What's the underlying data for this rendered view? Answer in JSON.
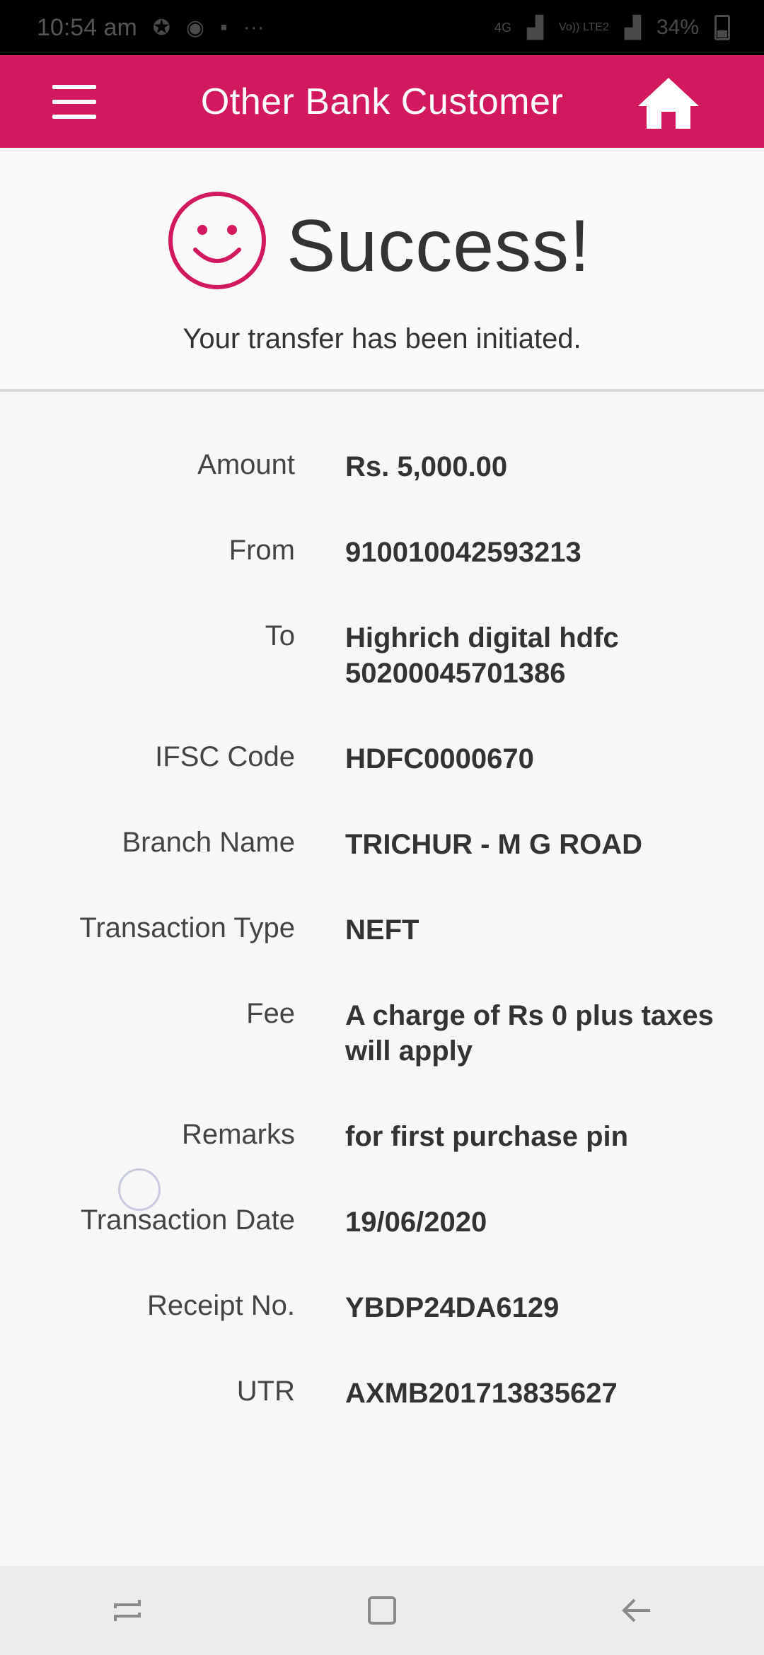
{
  "status_bar": {
    "time": "10:54 am",
    "more": "···",
    "network": "4G",
    "volte": "Vo)) LTE2",
    "battery": "34%"
  },
  "app_bar": {
    "title": "Other Bank Customer"
  },
  "success": {
    "title": "Success!",
    "message": "Your transfer has been initiated."
  },
  "details": [
    {
      "label": "Amount",
      "value": "Rs. 5,000.00"
    },
    {
      "label": "From",
      "value": "910010042593213"
    },
    {
      "label": "To",
      "value_line1": "Highrich digital hdfc",
      "value_line2": "50200045701386"
    },
    {
      "label": "IFSC Code",
      "value": "HDFC0000670"
    },
    {
      "label": "Branch Name",
      "value": "TRICHUR - M G ROAD"
    },
    {
      "label": "Transaction Type",
      "value": "NEFT"
    },
    {
      "label": "Fee",
      "value_line1": "A charge of Rs 0 plus taxes",
      "value_line2": "will apply"
    },
    {
      "label": "Remarks",
      "value": "for first purchase pin"
    },
    {
      "label": "Transaction Date",
      "value": "19/06/2020"
    },
    {
      "label": "Receipt No.",
      "value": "YBDP24DA6129"
    },
    {
      "label": "UTR",
      "value": "AXMB201713835627"
    }
  ],
  "colors": {
    "brand": "#d2185e",
    "status_bar": "#000000",
    "nav_bar": "#ececec"
  },
  "icons": [
    "menu-icon",
    "home-icon",
    "smiley-icon",
    "recent-apps-icon",
    "home-nav-icon",
    "back-icon"
  ]
}
